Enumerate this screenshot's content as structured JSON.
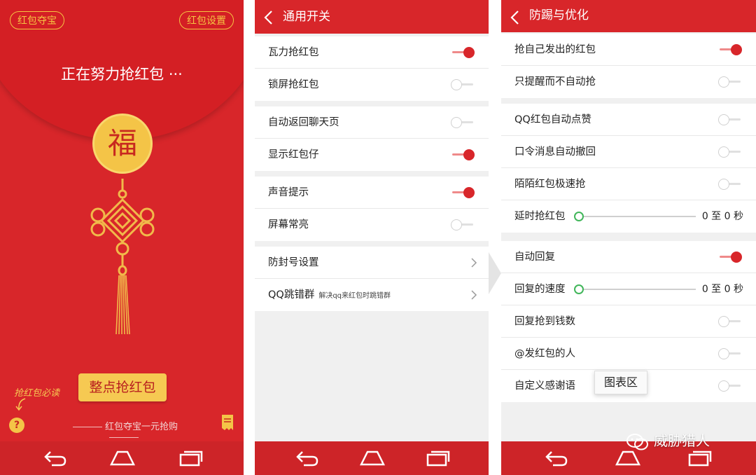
{
  "panel1": {
    "top_left_button": "红包夺宝",
    "top_right_button": "红包设置",
    "status": "正在努力抢红包 ···",
    "fu_char": "福",
    "grab_button": "整点抢红包",
    "hint": "抢红包必读",
    "help_glyph": "?",
    "bottom_text": "红包夺宝一元抢购"
  },
  "panel2": {
    "title": "通用开关",
    "groups": [
      [
        {
          "label": "瓦力抢红包",
          "toggle": true
        },
        {
          "label": "锁屏抢红包",
          "toggle": false
        }
      ],
      [
        {
          "label": "自动返回聊天页",
          "toggle": false
        },
        {
          "label": "显示红包仔",
          "toggle": true
        }
      ],
      [
        {
          "label": "声音提示",
          "toggle": true
        },
        {
          "label": "屏幕常亮",
          "toggle": false
        }
      ],
      [
        {
          "label": "防封号设置",
          "chevron": true
        },
        {
          "label": "QQ跳错群",
          "sub": "解决qq来红包时跳错群",
          "chevron": true
        }
      ]
    ]
  },
  "panel3": {
    "title": "防踢与优化",
    "groups": [
      [
        {
          "label": "抢自己发出的红包",
          "toggle": true
        },
        {
          "label": "只提醒而不自动抢",
          "toggle": false
        }
      ],
      [
        {
          "label": "QQ红包自动点赞",
          "toggle": false
        },
        {
          "label": "口令消息自动撤回",
          "toggle": false
        },
        {
          "label": "陌陌红包极速抢",
          "toggle": false
        },
        {
          "label": "延时抢红包",
          "slider": true,
          "value": "0 至 0 秒"
        }
      ],
      [
        {
          "label": "自动回复",
          "toggle": true
        },
        {
          "label": "回复的速度",
          "slider": true,
          "value": "0 至 0 秒"
        },
        {
          "label": "回复抢到钱数",
          "toggle": false
        },
        {
          "label": "@发红包的人",
          "toggle": false
        },
        {
          "label": "自定义感谢语",
          "toggle": false
        }
      ]
    ]
  },
  "overlay": {
    "tooltip": "图表区",
    "watermark": "威胁猎人"
  },
  "colors": {
    "brand_red": "#d8262a",
    "gold": "#f5c342",
    "toggle_on": "#d8262a",
    "slider_knob": "#41b65a"
  }
}
